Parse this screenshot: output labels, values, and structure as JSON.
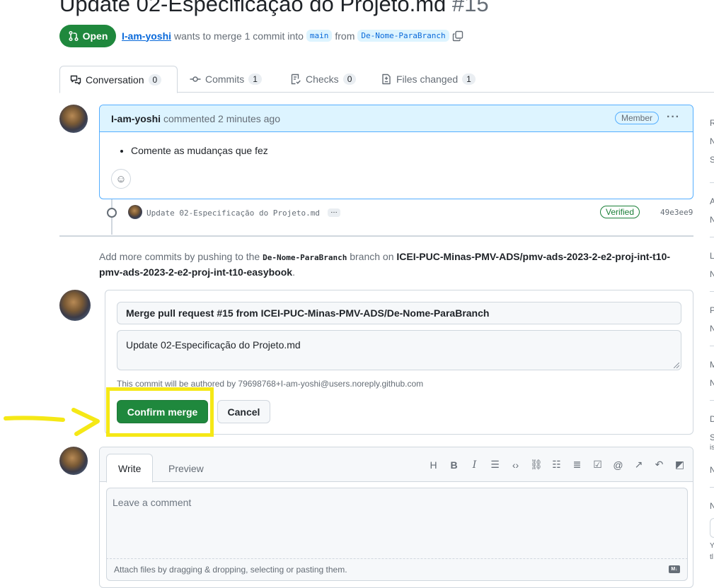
{
  "pr": {
    "title": "Update 02-Especificação do Projeto.md",
    "number": "#15",
    "state": "Open",
    "author": "I-am-yoshi",
    "merge_text": "wants to merge 1 commit into",
    "base_branch": "main",
    "from_text": "from",
    "head_branch": "De-Nome-ParaBranch"
  },
  "tabs": [
    {
      "label": "Conversation",
      "count": "0"
    },
    {
      "label": "Commits",
      "count": "1"
    },
    {
      "label": "Checks",
      "count": "0"
    },
    {
      "label": "Files changed",
      "count": "1"
    }
  ],
  "comment": {
    "author": "I-am-yoshi",
    "action": "commented 2 minutes ago",
    "badge": "Member",
    "body": "Comente as mudanças que fez"
  },
  "commit": {
    "message": "Update 02-Especificação do Projeto.md",
    "more": "…",
    "verified": "Verified",
    "sha": "49e3ee9"
  },
  "hint": {
    "prefix": "Add more commits by pushing to the",
    "branch": "De-Nome-ParaBranch",
    "middle": "branch on",
    "repo": "ICEI-PUC-Minas-PMV-ADS/pmv-ads-2023-2-e2-proj-int-t10-pmv-ads-2023-2-e2-proj-int-t10-easybook",
    "suffix": "."
  },
  "merge": {
    "title": "Merge pull request #15 from ICEI-PUC-Minas-PMV-ADS/De-Nome-ParaBranch",
    "message": "Update 02-Especificação do Projeto.md",
    "authored": "This commit will be authored by 79698768+I-am-yoshi@users.noreply.github.com",
    "confirm_label": "Confirm merge",
    "cancel_label": "Cancel"
  },
  "write": {
    "tab_write": "Write",
    "tab_preview": "Preview",
    "placeholder": "Leave a comment",
    "attach": "Attach files by dragging & dropping, selecting or pasting them.",
    "markdown_icon": "M↓"
  },
  "sidebar_letters": [
    "R",
    "N",
    "S",
    "A",
    "N",
    "L",
    "N",
    "P",
    "N",
    "M",
    "N",
    "D",
    "S",
    "is",
    "N",
    "N",
    "Y",
    "tl"
  ],
  "colors": {
    "accent": "#0969da",
    "success": "#1f883d",
    "highlight": "#f5e816"
  }
}
